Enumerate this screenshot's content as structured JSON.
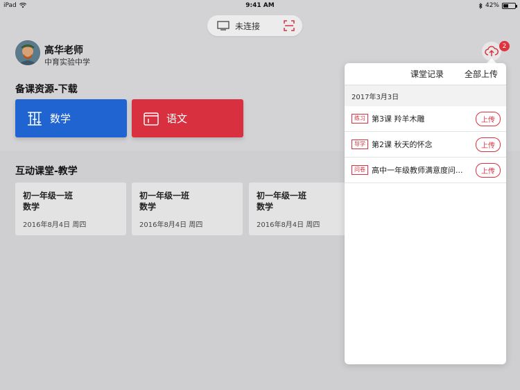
{
  "status_bar": {
    "device": "iPad",
    "time": "9:41 AM",
    "battery": "42%"
  },
  "connection": {
    "label": "未连接"
  },
  "profile": {
    "name": "高华老师",
    "school": "中育实验中学"
  },
  "upload": {
    "badge_count": "2"
  },
  "prep_section": {
    "title": "备课资源-下载"
  },
  "subjects": [
    {
      "label": "数学",
      "color": "#1f64d0"
    },
    {
      "label": "语文",
      "color": "#d9303f"
    }
  ],
  "classroom_section": {
    "title": "互动课堂-教学"
  },
  "class_cards": [
    {
      "name": "初一年级一班",
      "subject": "数学",
      "date": "2016年8月4日 周四"
    },
    {
      "name": "初一年级一班",
      "subject": "数学",
      "date": "2016年8月4日 周四"
    },
    {
      "name": "初一年级一班",
      "subject": "数学",
      "date": "2016年8月4日 周四"
    }
  ],
  "popover": {
    "record_label": "课堂记录",
    "upload_all_label": "全部上传",
    "date": "2017年3月3日",
    "records": [
      {
        "tag": "练习",
        "title": "第3课 羚羊木雕",
        "button": "上传"
      },
      {
        "tag": "导学",
        "title": "第2课 秋天的怀念",
        "button": "上传"
      },
      {
        "tag": "问卷",
        "title": "高中一年级教师满意度问...",
        "button": "上传"
      }
    ]
  },
  "colors": {
    "accent_red": "#d9303f",
    "accent_blue": "#1f64d0"
  }
}
